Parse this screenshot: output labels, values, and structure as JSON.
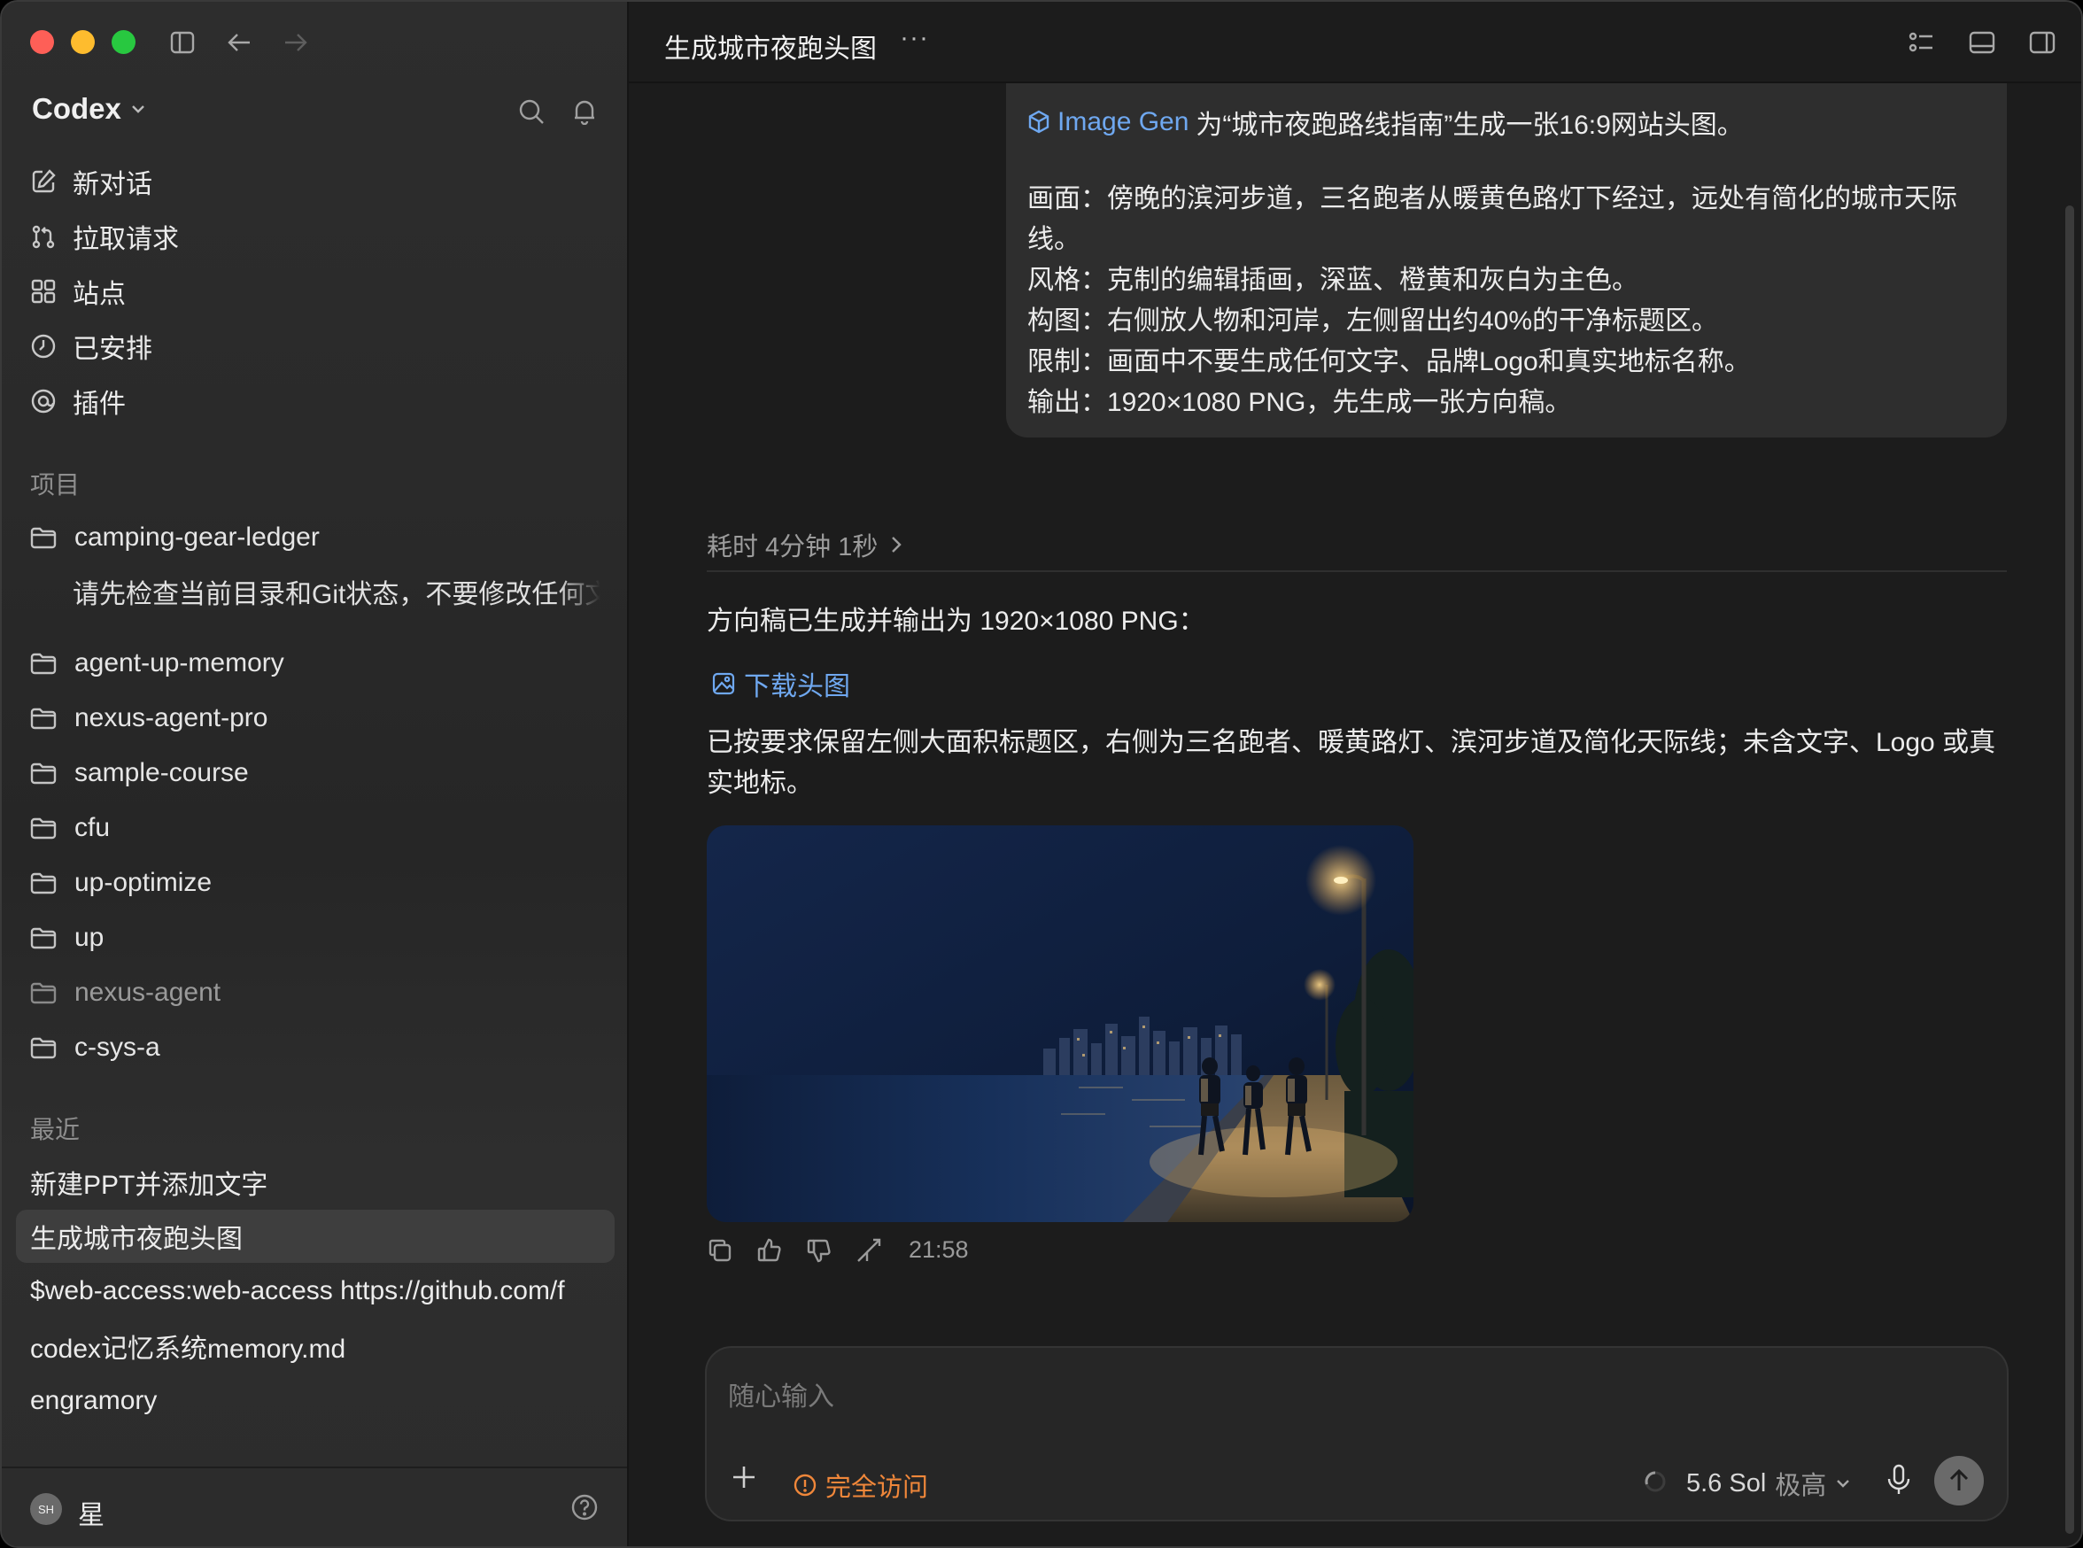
{
  "app": {
    "name": "Codex"
  },
  "sidebar": {
    "nav": [
      {
        "label": "新对话",
        "icon": "compose-icon"
      },
      {
        "label": "拉取请求",
        "icon": "pull-request-icon"
      },
      {
        "label": "站点",
        "icon": "sites-icon"
      },
      {
        "label": "已安排",
        "icon": "clock-icon"
      },
      {
        "label": "插件",
        "icon": "plugin-icon"
      }
    ],
    "projects_label": "项目",
    "projects": [
      {
        "name": "camping-gear-ledger"
      },
      {
        "name": "agent-up-memory"
      },
      {
        "name": "nexus-agent-pro"
      },
      {
        "name": "sample-course"
      },
      {
        "name": "cfu"
      },
      {
        "name": "up-optimize"
      },
      {
        "name": "up"
      },
      {
        "name": "nexus-agent"
      },
      {
        "name": "c-sys-a"
      }
    ],
    "project_thread": "请先检查当前目录和Git状态，不要修改任何文件",
    "recent_label": "最近",
    "recent": [
      "新建PPT并添加文字",
      "生成城市夜跑头图",
      "$web-access:web-access https://github.com/f",
      "codex记忆系统memory.md",
      "engramory"
    ],
    "user": {
      "initials": "SH",
      "name": "星"
    }
  },
  "header": {
    "title": "生成城市夜跑头图",
    "more": "···"
  },
  "conversation": {
    "user_message": {
      "tool_name": "Image Gen",
      "intro": "为“城市夜跑路线指南”生成一张16:9网站头图。",
      "lines": "画面：傍晚的滨河步道，三名跑者从暖黄色路灯下经过，远处有简化的城市天际线。\n风格：克制的编辑插画，深蓝、橙黄和灰白为主色。\n构图：右侧放人物和河岸，左侧留出约40%的干净标题区。\n限制：画面中不要生成任何文字、品牌Logo和真实地标名称。\n输出：1920×1080 PNG，先生成一张方向稿。"
    },
    "elapsed": "耗时 4分钟 1秒",
    "response": {
      "line1": "方向稿已生成并输出为 1920×1080 PNG：",
      "download_label": "下载头图",
      "paragraph": "已按要求保留左侧大面积标题区，右侧为三名跑者、暖黄路灯、滨河步道及简化天际线；未含文字、Logo 或真实地标。",
      "timestamp": "21:58"
    }
  },
  "composer": {
    "placeholder": "随心输入",
    "access_label": "完全访问",
    "model": "5.6 Sol",
    "effort": "极高"
  }
}
